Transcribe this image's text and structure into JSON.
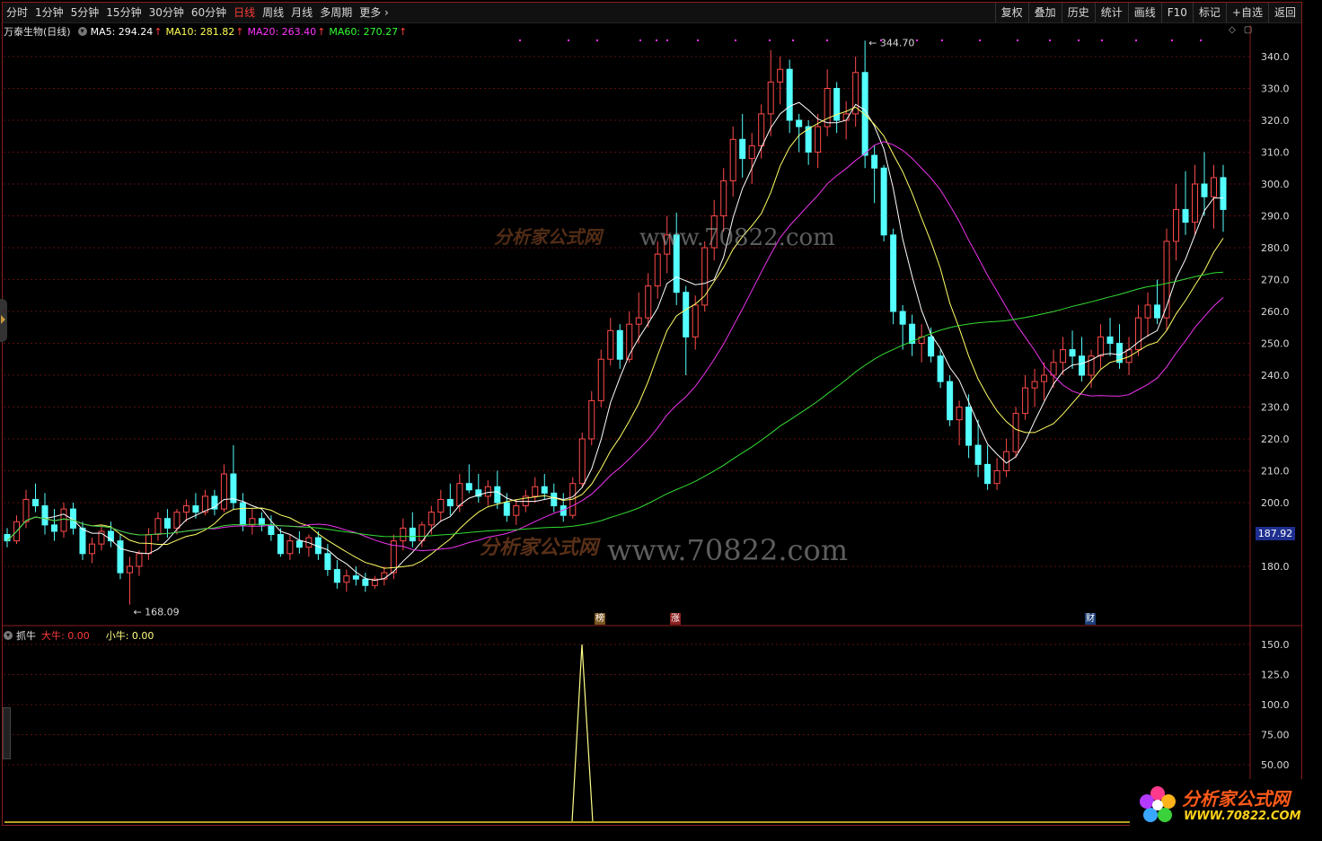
{
  "toolbar": {
    "periods": [
      "分时",
      "1分钟",
      "5分钟",
      "15分钟",
      "30分钟",
      "60分钟",
      "日线",
      "周线",
      "月线",
      "多周期",
      "更多"
    ],
    "active_period": "日线",
    "right": [
      "复权",
      "叠加",
      "历史",
      "统计",
      "画线",
      "F10",
      "标记",
      "+自选",
      "返回"
    ]
  },
  "stock": {
    "name": "万泰生物(日线)"
  },
  "ma": [
    {
      "label": "MA5: 294.24",
      "color": "#ffffff"
    },
    {
      "label": "MA10: 281.82",
      "color": "#ffff55"
    },
    {
      "label": "MA20: 263.40",
      "color": "#ff33ff"
    },
    {
      "label": "MA60: 270.27",
      "color": "#33ff33"
    }
  ],
  "ma_arrow": "↑",
  "price_axis": {
    "ticks": [
      "340.0",
      "330.0",
      "320.0",
      "310.0",
      "300.0",
      "290.0",
      "280.0",
      "270.0",
      "260.0",
      "250.0",
      "240.0",
      "230.0",
      "220.0",
      "210.0",
      "200.0",
      "180.0"
    ],
    "current": "187.92"
  },
  "annotations": {
    "high": "344.70",
    "low": "168.09"
  },
  "markers": [
    {
      "label": "榜",
      "color": "#7a5520"
    },
    {
      "label": "涨",
      "color": "#8a1f1f"
    },
    {
      "label": "财",
      "color": "#1d3f7a"
    }
  ],
  "indicator": {
    "name": "抓牛",
    "big": "大牛: 0.00",
    "small": "小牛: 0.00",
    "ticks": [
      "150.0",
      "125.0",
      "100.0",
      "75.00",
      "50.00"
    ]
  },
  "watermarks": {
    "url": "www.70822.com",
    "brand": "分析家公式网",
    "brand_url": "WWW.70822.COM"
  },
  "chart_data": {
    "type": "candlestick",
    "ylim": [
      170,
      345
    ],
    "candles": [
      [
        190,
        192,
        186,
        188
      ],
      [
        188,
        196,
        187,
        194
      ],
      [
        194,
        204,
        192,
        201
      ],
      [
        201,
        206,
        197,
        199
      ],
      [
        199,
        203,
        190,
        193
      ],
      [
        193,
        198,
        188,
        191
      ],
      [
        191,
        200,
        189,
        198
      ],
      [
        198,
        200,
        190,
        192
      ],
      [
        192,
        194,
        182,
        184
      ],
      [
        184,
        189,
        181,
        187
      ],
      [
        187,
        193,
        185,
        191
      ],
      [
        191,
        194,
        186,
        188
      ],
      [
        188,
        190,
        176,
        178
      ],
      [
        178,
        183,
        168,
        180
      ],
      [
        180,
        185,
        177,
        184
      ],
      [
        184,
        192,
        182,
        190
      ],
      [
        190,
        197,
        188,
        195
      ],
      [
        195,
        198,
        189,
        192
      ],
      [
        192,
        198,
        190,
        197
      ],
      [
        197,
        201,
        194,
        199
      ],
      [
        199,
        203,
        195,
        197
      ],
      [
        197,
        204,
        196,
        202
      ],
      [
        202,
        204,
        196,
        198
      ],
      [
        198,
        212,
        197,
        209
      ],
      [
        209,
        218,
        198,
        200
      ],
      [
        200,
        203,
        191,
        193
      ],
      [
        193,
        198,
        190,
        195
      ],
      [
        195,
        197,
        191,
        193
      ],
      [
        193,
        196,
        188,
        190
      ],
      [
        190,
        192,
        183,
        184
      ],
      [
        184,
        190,
        182,
        188
      ],
      [
        188,
        191,
        184,
        186
      ],
      [
        186,
        190,
        183,
        189
      ],
      [
        189,
        191,
        182,
        184
      ],
      [
        184,
        187,
        177,
        179
      ],
      [
        179,
        182,
        173,
        175
      ],
      [
        175,
        179,
        172,
        177
      ],
      [
        177,
        180,
        174,
        176
      ],
      [
        176,
        178,
        172,
        174
      ],
      [
        174,
        177,
        173,
        176
      ],
      [
        176,
        180,
        174,
        178
      ],
      [
        178,
        190,
        176,
        188
      ],
      [
        188,
        195,
        185,
        192
      ],
      [
        192,
        197,
        186,
        188
      ],
      [
        188,
        194,
        186,
        193
      ],
      [
        193,
        199,
        190,
        197
      ],
      [
        197,
        204,
        194,
        201
      ],
      [
        201,
        206,
        196,
        199
      ],
      [
        199,
        209,
        197,
        206
      ],
      [
        206,
        212,
        203,
        204
      ],
      [
        204,
        209,
        200,
        202
      ],
      [
        202,
        207,
        199,
        205
      ],
      [
        205,
        210,
        198,
        200
      ],
      [
        200,
        203,
        194,
        196
      ],
      [
        196,
        201,
        193,
        199
      ],
      [
        199,
        204,
        197,
        202
      ],
      [
        202,
        208,
        200,
        205
      ],
      [
        205,
        209,
        201,
        203
      ],
      [
        203,
        206,
        197,
        199
      ],
      [
        199,
        203,
        194,
        196
      ],
      [
        196,
        208,
        195,
        206
      ],
      [
        206,
        222,
        205,
        220
      ],
      [
        220,
        235,
        218,
        232
      ],
      [
        232,
        248,
        230,
        245
      ],
      [
        245,
        258,
        243,
        254
      ],
      [
        254,
        256,
        242,
        245
      ],
      [
        245,
        260,
        244,
        256
      ],
      [
        256,
        266,
        250,
        258
      ],
      [
        258,
        272,
        255,
        268
      ],
      [
        268,
        282,
        264,
        278
      ],
      [
        278,
        290,
        272,
        284
      ],
      [
        284,
        291,
        262,
        266
      ],
      [
        266,
        268,
        240,
        252
      ],
      [
        252,
        265,
        248,
        262
      ],
      [
        262,
        282,
        260,
        280
      ],
      [
        280,
        295,
        276,
        290
      ],
      [
        290,
        305,
        285,
        301
      ],
      [
        301,
        318,
        296,
        314
      ],
      [
        314,
        322,
        302,
        308
      ],
      [
        308,
        316,
        300,
        312
      ],
      [
        312,
        325,
        308,
        322
      ],
      [
        322,
        342,
        315,
        332
      ],
      [
        332,
        340,
        325,
        336
      ],
      [
        336,
        339,
        316,
        320
      ],
      [
        320,
        322,
        310,
        318
      ],
      [
        318,
        320,
        306,
        310
      ],
      [
        310,
        322,
        305,
        318
      ],
      [
        318,
        336,
        315,
        330
      ],
      [
        330,
        332,
        316,
        320
      ],
      [
        320,
        326,
        314,
        322
      ],
      [
        322,
        340,
        318,
        335
      ],
      [
        335,
        345,
        305,
        309
      ],
      [
        309,
        312,
        294,
        305
      ],
      [
        305,
        306,
        282,
        284
      ],
      [
        284,
        286,
        256,
        260
      ],
      [
        260,
        262,
        248,
        256
      ],
      [
        256,
        259,
        246,
        250
      ],
      [
        250,
        256,
        244,
        252
      ],
      [
        252,
        255,
        244,
        246
      ],
      [
        246,
        248,
        236,
        238
      ],
      [
        238,
        240,
        224,
        226
      ],
      [
        226,
        232,
        218,
        230
      ],
      [
        230,
        234,
        214,
        218
      ],
      [
        218,
        226,
        208,
        212
      ],
      [
        212,
        218,
        204,
        206
      ],
      [
        206,
        214,
        204,
        210
      ],
      [
        210,
        220,
        208,
        216
      ],
      [
        216,
        230,
        214,
        228
      ],
      [
        228,
        240,
        226,
        236
      ],
      [
        236,
        242,
        230,
        238
      ],
      [
        238,
        244,
        232,
        240
      ],
      [
        240,
        248,
        236,
        244
      ],
      [
        244,
        252,
        240,
        248
      ],
      [
        248,
        254,
        242,
        246
      ],
      [
        246,
        252,
        238,
        240
      ],
      [
        240,
        248,
        236,
        246
      ],
      [
        246,
        256,
        242,
        252
      ],
      [
        252,
        258,
        246,
        250
      ],
      [
        250,
        256,
        242,
        244
      ],
      [
        244,
        252,
        240,
        248
      ],
      [
        248,
        262,
        246,
        258
      ],
      [
        258,
        266,
        252,
        262
      ],
      [
        262,
        270,
        256,
        258
      ],
      [
        258,
        286,
        254,
        282
      ],
      [
        282,
        300,
        276,
        292
      ],
      [
        292,
        304,
        284,
        288
      ],
      [
        288,
        306,
        284,
        300
      ],
      [
        300,
        310,
        290,
        296
      ],
      [
        296,
        306,
        286,
        302
      ],
      [
        302,
        306,
        285,
        292
      ]
    ],
    "ma_labels": [
      "MA5",
      "MA10",
      "MA20",
      "MA60"
    ]
  }
}
